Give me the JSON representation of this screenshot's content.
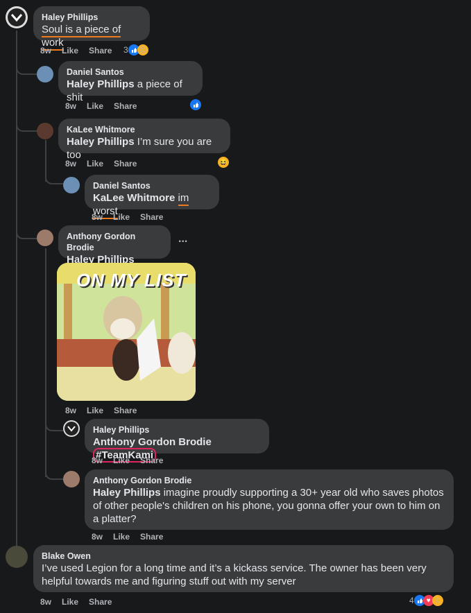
{
  "comments": [
    {
      "name": "Haley Phillips",
      "text": "Soul is a piece of work",
      "time": "8w",
      "like": "Like",
      "share": "Share",
      "reactions": "3"
    },
    {
      "name": "Daniel Santos",
      "mention": "Haley Phillips",
      "text": "a piece of shit",
      "time": "8w",
      "like": "Like",
      "share": "Share"
    },
    {
      "name": "KaLee Whitmore",
      "mention": "Haley Phillips",
      "text": "I’m sure you are too",
      "time": "8w",
      "like": "Like",
      "share": "Share"
    },
    {
      "name": "Daniel Santos",
      "mention": "KaLee Whitmore",
      "text": "im worst",
      "time": "8w",
      "like": "Like",
      "share": "Share"
    },
    {
      "name": "Anthony Gordon Brodie",
      "mention": "Haley Phillips",
      "more": "...",
      "gif_text": "ON MY LIST",
      "time": "8w",
      "like": "Like",
      "share": "Share"
    },
    {
      "name": "Haley Phillips",
      "mention": "Anthony Gordon Brodie",
      "text": "#TeamKami",
      "time": "8w",
      "like": "Like",
      "share": "Share"
    },
    {
      "name": "Anthony Gordon Brodie",
      "mention": "Haley Phillips",
      "text": "imagine proudly supporting a 30+ year old who saves photos of other people's children on his phone, you gonna offer your own to him on a platter?",
      "time": "8w",
      "like": "Like",
      "share": "Share"
    },
    {
      "name": "Blake Owen",
      "text": "I’ve used Legion for a long time and it’s a kickass service. The owner has been very helpful towards me and figuring stuff out with my server",
      "time": "8w",
      "like": "Like",
      "share": "Share",
      "reactions": "4"
    }
  ],
  "colors": {
    "bubble": "#3a3b3c",
    "background": "#18191a",
    "like": "#1877f2",
    "highlight": "#f07b1e",
    "circle": "#e0245e"
  }
}
